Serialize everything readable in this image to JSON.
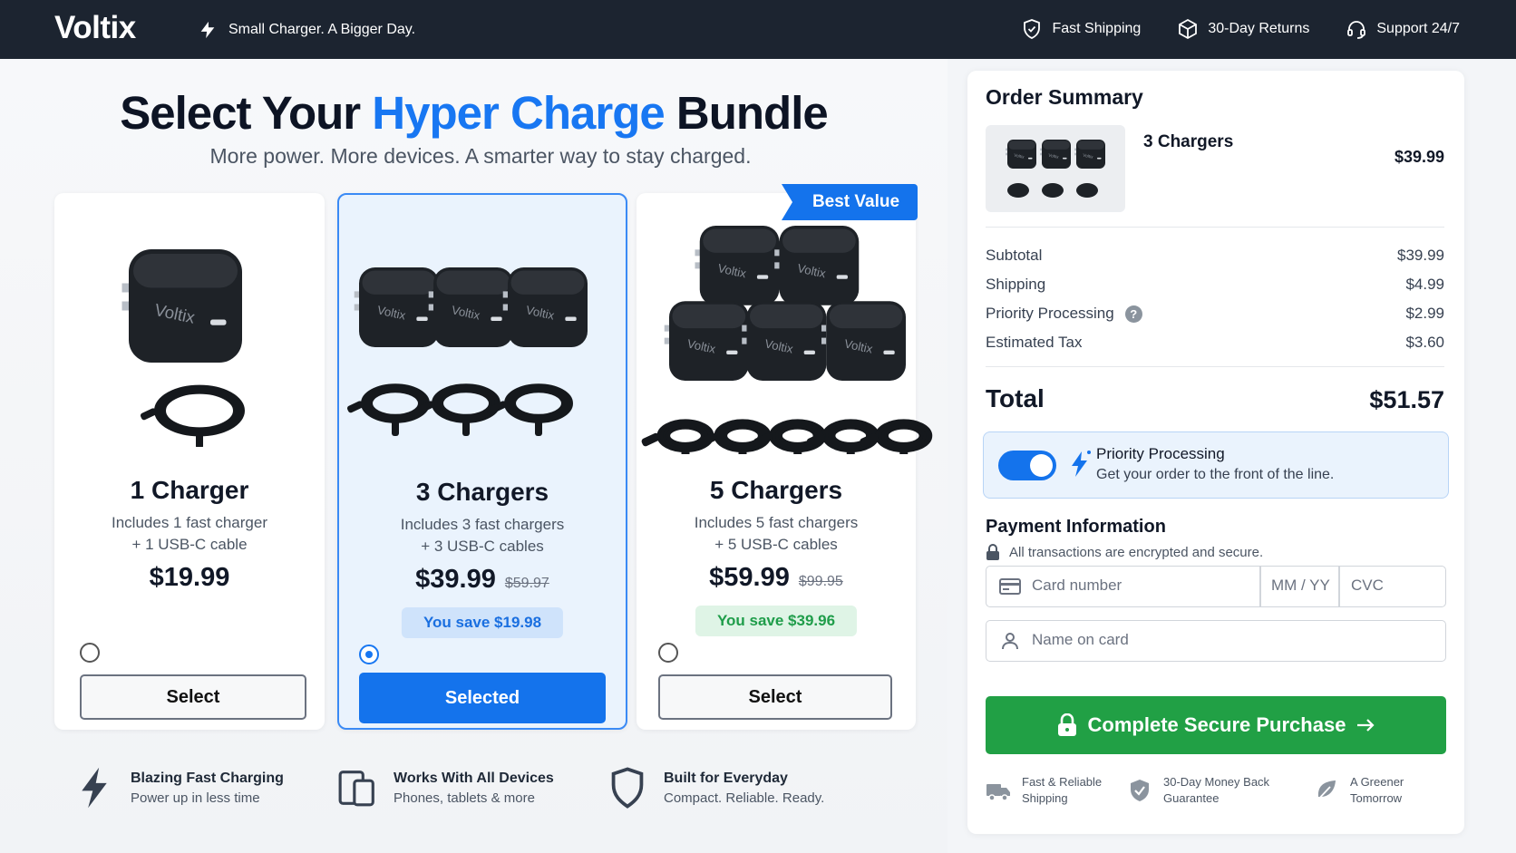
{
  "header": {
    "brand": "Voltix",
    "tagline": "Small Charger. A Bigger Day.",
    "badges": [
      {
        "label": "Fast Shipping",
        "icon": "shield-check-icon"
      },
      {
        "label": "30-Day Returns",
        "icon": "box-icon"
      },
      {
        "label": "Support 24/7",
        "icon": "headset-icon"
      }
    ]
  },
  "hero": {
    "title_part1": "Select Your ",
    "title_accent": "Hyper Charge",
    "title_part2": " Bundle",
    "subtitle": "More power. More devices. A smarter way to stay charged."
  },
  "bundles": [
    {
      "title": "1 Charger",
      "desc1": "Includes 1 fast charger",
      "desc2": "+ 1 USB-C cable",
      "price": "$19.99",
      "was": "",
      "save": "",
      "button": "Select",
      "selected": false,
      "chargers": 1
    },
    {
      "title": "3 Chargers",
      "desc1": "Includes 3 fast chargers",
      "desc2": "+ 3 USB-C cables",
      "price": "$39.99",
      "was": "$59.97",
      "save": "You save $19.98",
      "button": "Selected",
      "selected": true,
      "chargers": 3
    },
    {
      "title": "5 Chargers",
      "desc1": "Includes 5 fast chargers",
      "desc2": "+ 5 USB-C cables",
      "price": "$59.99",
      "was": "$99.95",
      "save": "You save $39.96",
      "button": "Select",
      "selected": false,
      "chargers": 5
    }
  ],
  "best_value_label": "Best Value",
  "charger_brand": "Voltix",
  "features": [
    {
      "title": "Blazing Fast Charging",
      "sub": "Power up in less time",
      "icon": "bolt-icon"
    },
    {
      "title": "Works With All Devices",
      "sub": "Phones, tablets & more",
      "icon": "devices-icon"
    },
    {
      "title": "Built for Everyday",
      "sub": "Compact. Reliable. Ready.",
      "icon": "shield-icon"
    }
  ],
  "summary": {
    "title": "Order Summary",
    "item_name": "3 Chargers",
    "item_price": "$39.99",
    "lines": [
      {
        "label": "Subtotal",
        "value": "$39.99"
      },
      {
        "label": "Shipping",
        "value": "$4.99"
      },
      {
        "label": "Priority Processing",
        "value": "$2.99",
        "help": "?"
      },
      {
        "label": "Estimated Tax",
        "value": "$3.60"
      }
    ],
    "total_label": "Total",
    "total_value": "$51.57",
    "priority": {
      "title": "Priority Processing",
      "sub": "Get your order to the front of the line.",
      "enabled": true
    },
    "payment_title": "Payment Information",
    "payment_note": "All transactions are encrypted and secure.",
    "card_placeholder": "Card number",
    "expiry_placeholder": "MM / YY",
    "cvc_placeholder": "CVC",
    "name_placeholder": "Name on card",
    "purchase_label": "Complete Secure Purchase",
    "trust": [
      {
        "line1": "Fast & Reliable",
        "line2": "Shipping",
        "icon": "truck-icon"
      },
      {
        "line1": "30-Day Money Back",
        "line2": "Guarantee",
        "icon": "shield-check-icon"
      },
      {
        "line1": "A Greener",
        "line2": "Tomorrow",
        "icon": "leaf-icon"
      }
    ]
  },
  "colors": {
    "accent": "#1473ec",
    "header_bg": "#1c2430",
    "success": "#21a045"
  }
}
